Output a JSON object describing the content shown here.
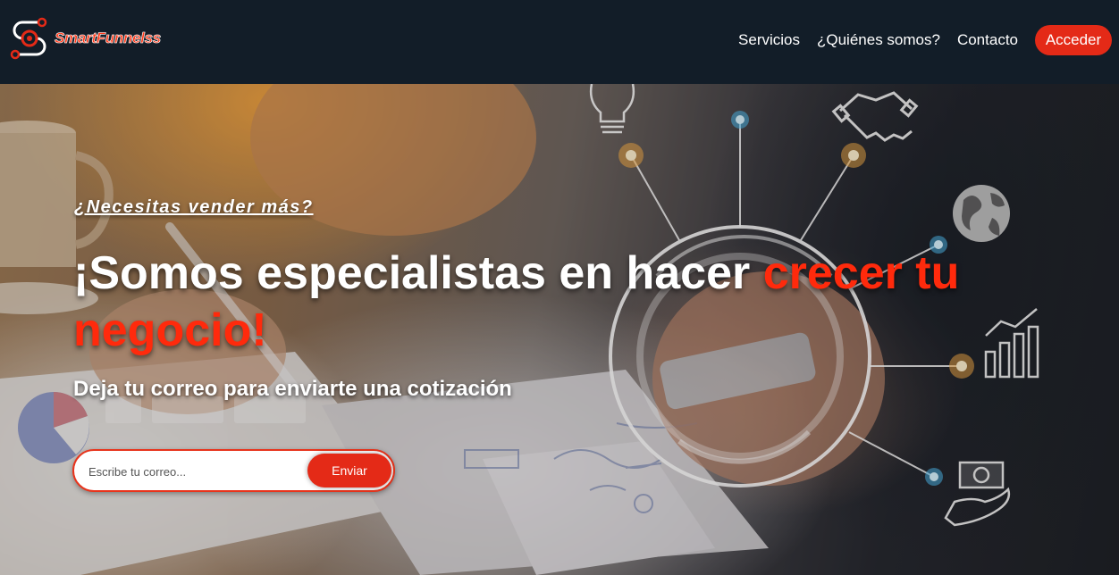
{
  "header": {
    "logo_text": "SmartFunnelss",
    "nav": [
      {
        "label": "Servicios"
      },
      {
        "label": "¿Quiénes somos?"
      },
      {
        "label": "Contacto"
      }
    ],
    "login_label": "Acceder"
  },
  "hero": {
    "eyebrow": "¿Necesitas vender más?",
    "headline_white": "¡Somos especialistas en hacer ",
    "headline_red": "crecer tu negocio!",
    "subtitle": "Deja tu correo para enviarte una cotización",
    "email_placeholder": "Escribe tu correo...",
    "submit_label": "Enviar"
  },
  "colors": {
    "header_bg": "#121d28",
    "accent": "#e42a17",
    "headline_red": "#ff2a0c"
  },
  "icons": [
    "logo-mark-icon",
    "lightbulb-icon",
    "handshake-icon",
    "globe-icon",
    "bar-chart-icon",
    "money-hand-icon"
  ]
}
